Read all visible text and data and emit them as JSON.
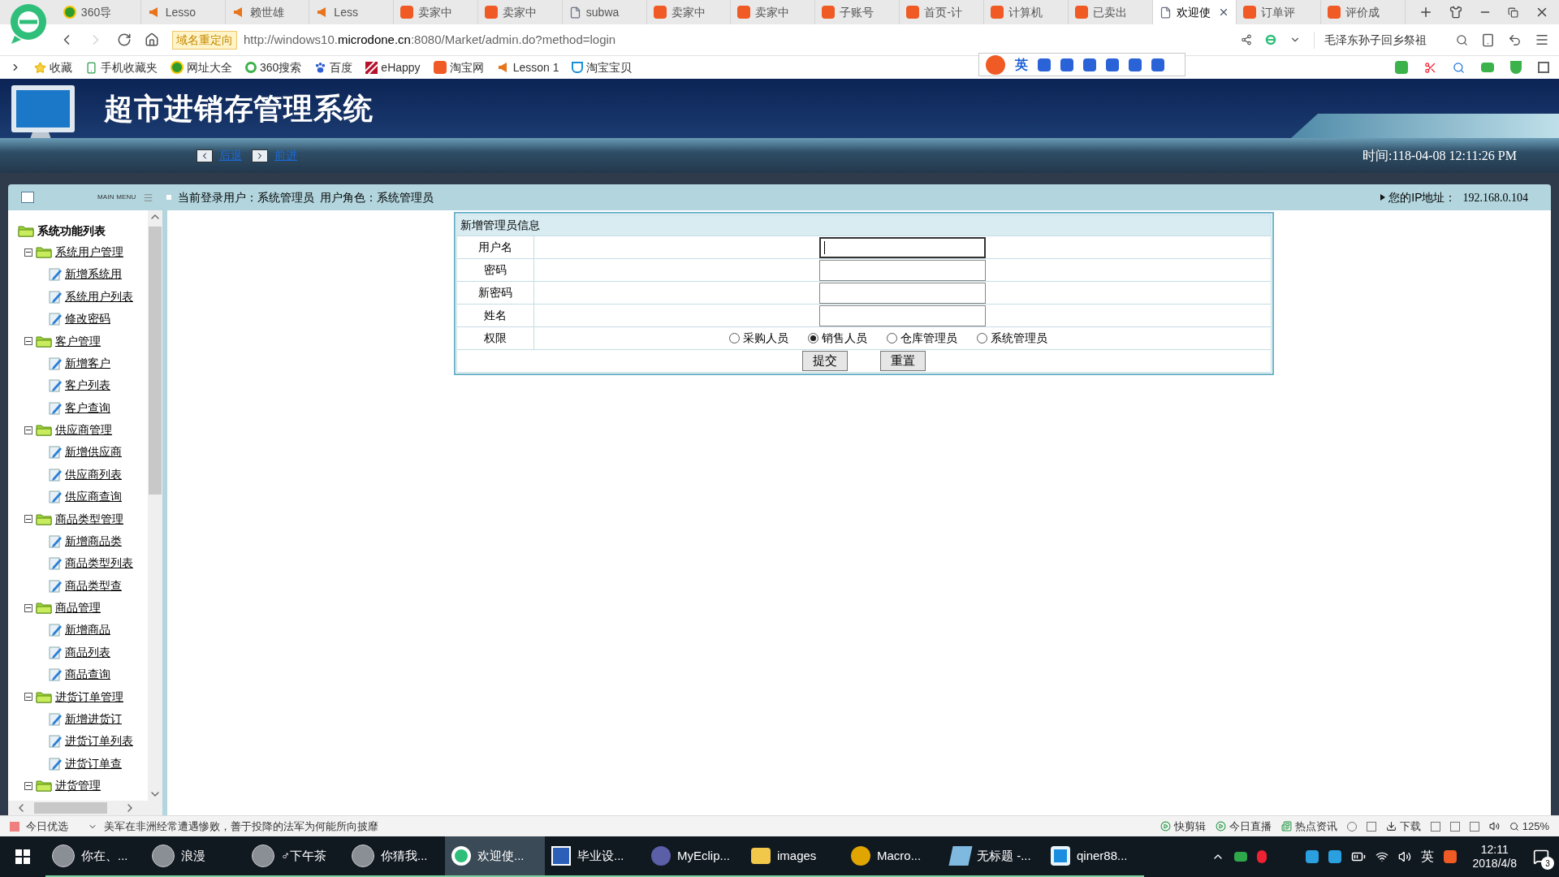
{
  "browser": {
    "tabs": [
      {
        "label": "360导",
        "selected": false,
        "kind": "plus"
      },
      {
        "label": "Lesso",
        "selected": false,
        "kind": "horn"
      },
      {
        "label": "赖世雄",
        "selected": false,
        "kind": "horn"
      },
      {
        "label": "Less",
        "selected": false,
        "kind": "horn"
      },
      {
        "label": "卖家中",
        "selected": false,
        "kind": "tao"
      },
      {
        "label": "卖家中",
        "selected": false,
        "kind": "tao"
      },
      {
        "label": "subwa",
        "selected": false,
        "kind": "page"
      },
      {
        "label": "卖家中",
        "selected": false,
        "kind": "tao"
      },
      {
        "label": "卖家中",
        "selected": false,
        "kind": "tao"
      },
      {
        "label": "子账号",
        "selected": false,
        "kind": "tao"
      },
      {
        "label": "首页-计",
        "selected": false,
        "kind": "tao"
      },
      {
        "label": "计算机",
        "selected": false,
        "kind": "tao"
      },
      {
        "label": "已卖出",
        "selected": false,
        "kind": "tao"
      },
      {
        "label": "欢迎使",
        "selected": true,
        "kind": "page"
      },
      {
        "label": "订单评",
        "selected": false,
        "kind": "tao"
      },
      {
        "label": "评价成",
        "selected": false,
        "kind": "tao"
      }
    ],
    "redirect_badge": "域名重定向",
    "url": "http://windows10.**microdone.cn**:8080/Market/admin.do?method=login",
    "search_text": "毛泽东孙子回乡祭祖",
    "bookmarks": [
      {
        "label": "收藏",
        "kind": "star"
      },
      {
        "label": "手机收藏夹",
        "kind": "phone"
      },
      {
        "label": "网址大全",
        "kind": "plus"
      },
      {
        "label": "360搜索",
        "kind": "ring"
      },
      {
        "label": "百度",
        "kind": "paw"
      },
      {
        "label": "eHappy",
        "kind": "stripes"
      },
      {
        "label": "淘宝网",
        "kind": "tao"
      },
      {
        "label": "Lesson 1",
        "kind": "horn"
      },
      {
        "label": "淘宝宝贝",
        "kind": "cup"
      }
    ],
    "ime_label": "英"
  },
  "app": {
    "title": "超市进销存管理系统",
    "nav": [
      {
        "label": "后退",
        "kind": "back"
      },
      {
        "label": "前进",
        "kind": "forward"
      }
    ],
    "time": "时间:118-04-08 12:11:26 PM",
    "menu_label": "MAIN MENU",
    "user_info": "当前登录用户：系统管理员  用户角色：系统管理员",
    "ip_label": "您的IP地址：",
    "ip": "192.168.0.104"
  },
  "sidebar": {
    "root": "系统功能列表",
    "groups": [
      {
        "label": "系统用户管理",
        "expanded": true,
        "children": [
          {
            "label": "新增系统用"
          },
          {
            "label": "系统用户列表"
          },
          {
            "label": "修改密码"
          }
        ]
      },
      {
        "label": "客户管理",
        "expanded": true,
        "children": [
          {
            "label": "新增客户"
          },
          {
            "label": "客户列表"
          },
          {
            "label": "客户查询"
          }
        ]
      },
      {
        "label": "供应商管理",
        "expanded": true,
        "children": [
          {
            "label": "新增供应商"
          },
          {
            "label": "供应商列表"
          },
          {
            "label": "供应商查询"
          }
        ]
      },
      {
        "label": "商品类型管理",
        "expanded": true,
        "children": [
          {
            "label": "新增商品类"
          },
          {
            "label": "商品类型列表"
          },
          {
            "label": "商品类型查"
          }
        ]
      },
      {
        "label": "商品管理",
        "expanded": true,
        "children": [
          {
            "label": "新增商品"
          },
          {
            "label": "商品列表"
          },
          {
            "label": "商品查询"
          }
        ]
      },
      {
        "label": "进货订单管理",
        "expanded": true,
        "children": [
          {
            "label": "新增进货订"
          },
          {
            "label": "进货订单列表"
          },
          {
            "label": "进货订单查"
          }
        ]
      },
      {
        "label": "进货管理",
        "expanded": true
      }
    ]
  },
  "form": {
    "title": "新增管理员信息",
    "fields": [
      {
        "label": "用户名",
        "focused": true
      },
      {
        "label": "密码",
        "focused": false
      },
      {
        "label": "新密码",
        "focused": false
      },
      {
        "label": "姓名",
        "focused": false
      }
    ],
    "role": {
      "label": "权限",
      "options": [
        {
          "label": "采购人员",
          "selected": false
        },
        {
          "label": "销售人员",
          "selected": true
        },
        {
          "label": "仓库管理员",
          "selected": false
        },
        {
          "label": "系统管理员",
          "selected": false
        }
      ]
    },
    "buttons": [
      "提交",
      "重置"
    ]
  },
  "status_bar": {
    "left": "今日优选",
    "news": "美军在非洲经常遭遇惨败，善于投降的法军为何能所向披靡",
    "right": [
      "快剪辑",
      "今日直播",
      "热点资讯"
    ],
    "download": "下载",
    "zoom": "125%"
  },
  "taskbar": {
    "items": [
      {
        "label": "你在、...",
        "kind": "avatar",
        "active": false
      },
      {
        "label": "浪漫",
        "kind": "avatar",
        "active": false
      },
      {
        "label": "♂下午茶",
        "kind": "avatar",
        "active": false
      },
      {
        "label": "你猜我...",
        "kind": "avatar",
        "active": false
      },
      {
        "label": "欢迎使...",
        "kind": "browser",
        "active": true
      },
      {
        "label": "毕业设...",
        "kind": "word",
        "active": false
      },
      {
        "label": "MyEclip...",
        "kind": "m",
        "active": false
      },
      {
        "label": "images",
        "kind": "folder",
        "active": false
      },
      {
        "label": "Macro...",
        "kind": "macro",
        "active": false
      },
      {
        "label": "无标题 -...",
        "kind": "paint",
        "active": false
      },
      {
        "label": "qiner88...",
        "kind": "q",
        "active": false
      }
    ],
    "ime": "英",
    "time": "12:11",
    "date": "2018/4/8",
    "notifications": "3"
  }
}
